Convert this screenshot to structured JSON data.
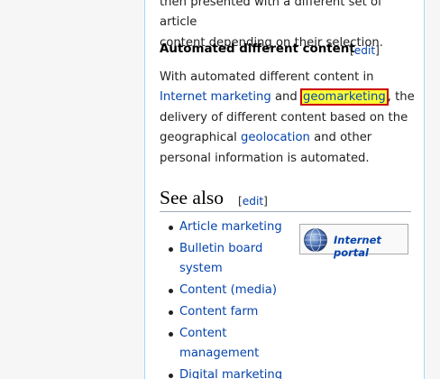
{
  "top_para": {
    "line1": "then presented with a different set of article",
    "line2": "content depending on their selection."
  },
  "section_auto": {
    "heading": "Automated different content",
    "edit_label": "edit"
  },
  "auto_para": {
    "t1": "With automated different content in ",
    "link_internet_marketing": "Internet marketing",
    "t2": " and ",
    "link_geomarketing": "geomarketing",
    "t3": ", the delivery of different content based on the geographical ",
    "link_geolocation": "geolocation",
    "t4": " and other personal information is automated."
  },
  "see_also": {
    "heading": "See also",
    "edit_label": "edit",
    "items": [
      "Article marketing",
      "Bulletin board system",
      "Content (media)",
      "Content farm",
      "Content management",
      "Digital marketing"
    ]
  },
  "portal": {
    "label": "Internet portal",
    "icon": "globe-icon"
  },
  "colors": {
    "link": "#0645ad",
    "highlight_fill": "#ffff33",
    "highlight_border": "#cc0000"
  }
}
